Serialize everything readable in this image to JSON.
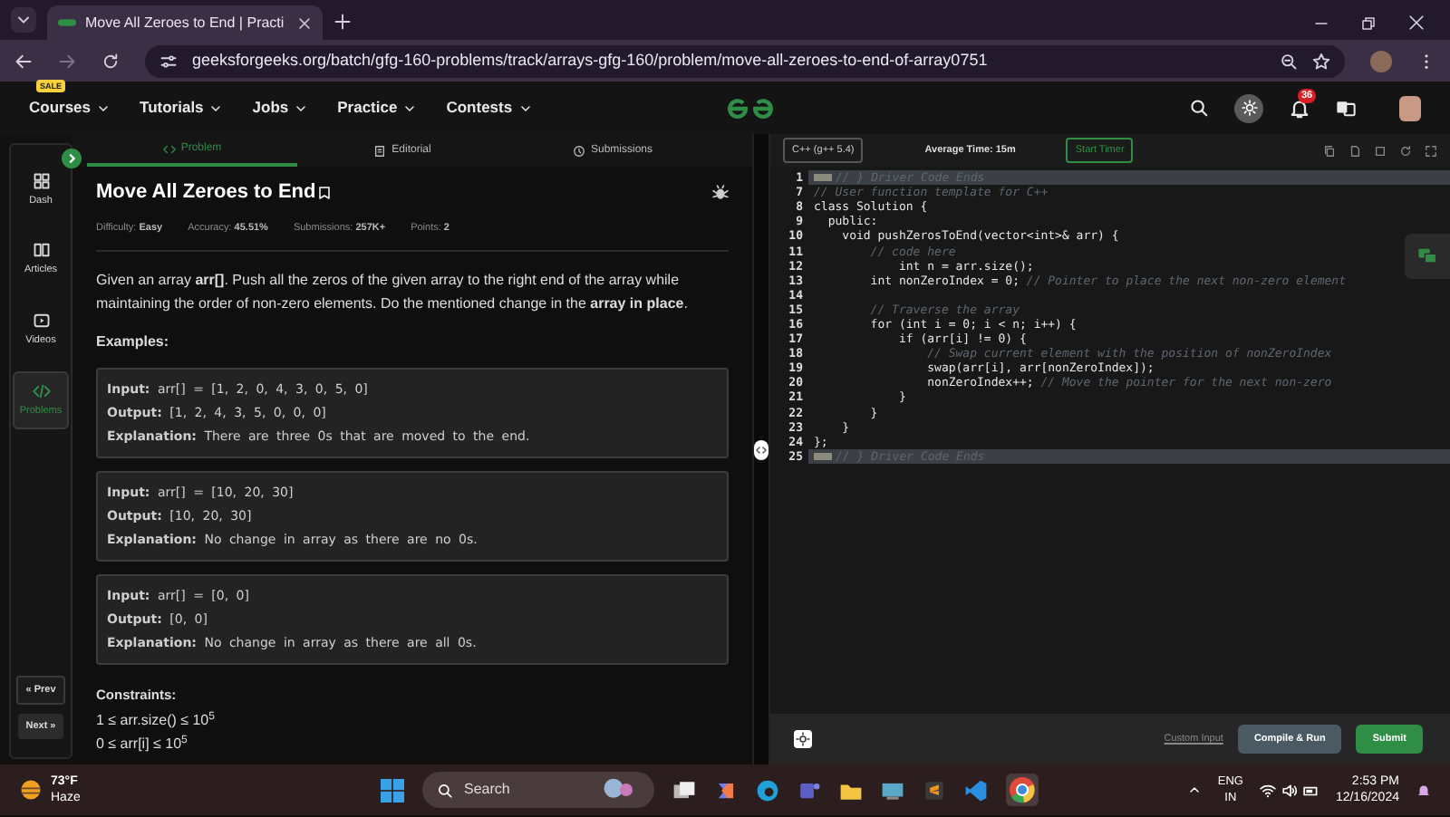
{
  "browser": {
    "tab_title": "Move All Zeroes to End | Practi",
    "url": "geeksforgeeks.org/batch/gfg-160-problems/track/arrays-gfg-160/problem/move-all-zeroes-to-end-of-array0751"
  },
  "site_nav": {
    "sale_badge": "SALE",
    "items": [
      "Courses",
      "Tutorials",
      "Jobs",
      "Practice",
      "Contests"
    ],
    "notification_count": "36"
  },
  "sidebar": {
    "items": [
      {
        "label": "Dash",
        "selected": false
      },
      {
        "label": "Articles",
        "selected": false
      },
      {
        "label": "Videos",
        "selected": false
      },
      {
        "label": "Problems",
        "selected": true
      }
    ],
    "prev": "« Prev",
    "next": "Next »"
  },
  "tabs": [
    {
      "label": "Problem",
      "selected": true
    },
    {
      "label": "Editorial",
      "selected": false
    },
    {
      "label": "Submissions",
      "selected": false
    }
  ],
  "problem": {
    "title": "Move All Zeroes to End",
    "meta": [
      {
        "label": "Difficulty:",
        "value": "Easy"
      },
      {
        "label": "Accuracy:",
        "value": "45.51%"
      },
      {
        "label": "Submissions:",
        "value": "257K+"
      },
      {
        "label": "Points:",
        "value": "2"
      }
    ],
    "description": "Given an array **arr[]**. Push all the zeros of the given array to the right end of the array while maintaining the order of non-zero elements. Do the mentioned change in the **array in place**.",
    "examples_heading": "Examples:",
    "examples": [
      [
        "**Input:** arr[] = [1, 2, 0, 4, 3, 0, 5, 0]",
        "**Output:** [1, 2, 4, 3, 5, 0, 0, 0]",
        "**Explanation:** There are three 0s that are moved to the end."
      ],
      [
        "**Input:** arr[] = [10, 20, 30]",
        "**Output:** [10, 20, 30]",
        "**Explanation:** No change in array as there are no 0s."
      ],
      [
        "**Input:** arr[] = [0, 0]",
        "**Output:** [0, 0]",
        "**Explanation:** No change in array as there are all 0s."
      ]
    ],
    "constraints_heading": "Constraints:",
    "constraints": [
      "1 ≤ arr.size() ≤ 10$^{5}$",
      "0 ≤ arr[i] ≤ 10$^{5}$"
    ]
  },
  "editor": {
    "language": "C++ (g++ 5.4)",
    "average_time": "Average Time: 15m",
    "timer_button": "Start Timer",
    "lines": [
      {
        "number": "1",
        "folded": true,
        "comment": "// } Driver Code Ends"
      },
      {
        "number": "7",
        "folded": false,
        "comment": "// User function template for C++"
      },
      {
        "number": "8",
        "folded": false,
        "code": "class Solution {"
      },
      {
        "number": "9",
        "folded": false,
        "code": "  public:"
      },
      {
        "number": "10",
        "folded": false,
        "code": "    void pushZerosToEnd(vector<int>& arr) {"
      },
      {
        "number": "11",
        "folded": false,
        "comment": "        // code here"
      },
      {
        "number": "12",
        "folded": false,
        "code": "            int n = arr.size();"
      },
      {
        "number": "13",
        "folded": false,
        "code": "        int nonZeroIndex = 0; ",
        "comment": "// Pointer to place the next non-zero element"
      },
      {
        "number": "14",
        "folded": false
      },
      {
        "number": "15",
        "folded": false,
        "comment": "        // Traverse the array"
      },
      {
        "number": "16",
        "folded": false,
        "code": "        for (int i = 0; i < n; i++) {"
      },
      {
        "number": "17",
        "folded": false,
        "code": "            if (arr[i] != 0) {"
      },
      {
        "number": "18",
        "folded": false,
        "comment": "                // Swap current element with the position of nonZeroIndex"
      },
      {
        "number": "19",
        "folded": false,
        "code": "                swap(arr[i], arr[nonZeroIndex]);"
      },
      {
        "number": "20",
        "folded": false,
        "code": "                nonZeroIndex++; ",
        "comment": "// Move the pointer for the next non-zero"
      },
      {
        "number": "21",
        "folded": false,
        "code": "            }"
      },
      {
        "number": "22",
        "folded": false,
        "code": "        }"
      },
      {
        "number": "23",
        "folded": false,
        "code": "    }"
      },
      {
        "number": "24",
        "folded": false,
        "code": "};"
      },
      {
        "number": "25",
        "folded": true,
        "comment": "// } Driver Code Ends"
      }
    ],
    "custom_input": "Custom Input",
    "compile_button": "Compile & Run",
    "submit_button": "Submit"
  },
  "taskbar": {
    "temperature": "73°F",
    "weather": "Haze",
    "search_placeholder": "Search",
    "language": "ENG",
    "region": "IN",
    "time": "2:53 PM",
    "date": "12/16/2024"
  }
}
